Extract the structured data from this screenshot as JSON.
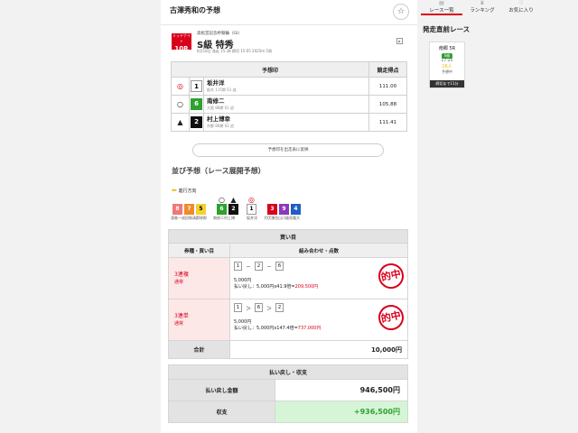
{
  "header": {
    "title": "古澤秀和の予想",
    "favorite_icon": "star-icon"
  },
  "race": {
    "grade_label": "ミッドナイト",
    "race_number": "10R",
    "subtitle": "高松宮記念杯競輪（GⅠ）",
    "name": "S級 特秀",
    "meta": "6月18日 発走 15:38 締切 15:05 2025m 5周"
  },
  "prediction": {
    "col_label": "予想印",
    "col_points": "競走得点",
    "rows": [
      {
        "mark": "◎",
        "num": "1",
        "color": "#ffffff",
        "text_color": "#000000",
        "name": "坂井洋",
        "info": "栃木 115期 S1 逃",
        "points": "111.00"
      },
      {
        "mark": "○",
        "num": "6",
        "color": "#2ea12e",
        "text_color": "#ffffff",
        "name": "南修二",
        "info": "大阪 88期 S1 追",
        "points": "105.88"
      },
      {
        "mark": "▲",
        "num": "2",
        "color": "#111111",
        "text_color": "#ffffff",
        "name": "村上博幸",
        "info": "京都 86期 S1 追",
        "points": "111.41"
      }
    ],
    "reflect_label": "予想印を出走表に反映"
  },
  "lineup": {
    "title": "並び予想（レース展開予想）",
    "direction_label": "進行方向",
    "boxes": [
      {
        "num": "8",
        "color": "#f07878",
        "text_color": "#ffffff"
      },
      {
        "num": "7",
        "color": "#f08a2c",
        "text_color": "#ffffff"
      },
      {
        "num": "5",
        "color": "#f2d22e",
        "text_color": "#000000"
      },
      {
        "num": "6",
        "color": "#2ea12e",
        "text_color": "#ffffff"
      },
      {
        "num": "2",
        "color": "#111111",
        "text_color": "#ffffff"
      },
      {
        "num": "1",
        "color": "#ffffff",
        "text_color": "#000000"
      },
      {
        "num": "3",
        "color": "#d9001b",
        "text_color": "#ffffff"
      },
      {
        "num": "9",
        "color": "#8a3ab9",
        "text_color": "#ffffff"
      },
      {
        "num": "4",
        "color": "#1f5fc4",
        "text_color": "#ffffff"
      }
    ],
    "marks": [
      "○",
      "▲",
      "◎"
    ],
    "labels": [
      "酒巻一成田和清郡修郎",
      "南修二村上博",
      "坂井洋",
      "犬伏湧也山口雄亮隆大"
    ]
  },
  "buy": {
    "title": "買い目",
    "col_type": "券種・買い目",
    "col_combo": "組み合わせ・点数",
    "bets": [
      {
        "type": "3連複",
        "sub": "通常",
        "nums": [
          "1",
          "2",
          "6"
        ],
        "sep": "－",
        "amount": "5,000円",
        "payout_prefix": "払い戻し：5,000円x41.9倍=",
        "payout": "209,500円",
        "hit": "的中"
      },
      {
        "type": "3連単",
        "sub": "通常",
        "nums": [
          "1",
          "6",
          "2"
        ],
        "sep": "＞",
        "amount": "5,000円",
        "payout_prefix": "払い戻し：5,000円x147.4倍=",
        "payout": "737,000円",
        "hit": "的中"
      }
    ],
    "total_label": "合計",
    "total_value": "10,000円"
  },
  "summary": {
    "title": "払い戻し・収支",
    "payout_label": "払い戻し金額",
    "payout_value": "946,500円",
    "balance_label": "収支",
    "balance_value": "+936,500円"
  },
  "side": {
    "nav": [
      {
        "label": "レース一覧",
        "icon": "list-icon"
      },
      {
        "label": "ランキング",
        "icon": "ranking-icon"
      },
      {
        "label": "お気に入り",
        "icon": "favorite-icon"
      }
    ],
    "soon_title": "発走直前レース",
    "card": {
      "venue": "南郷 5R",
      "status": "S級",
      "time": "17:25",
      "count": "16人",
      "pre_label": "予想中",
      "bar_label": "締切まで11分"
    }
  }
}
